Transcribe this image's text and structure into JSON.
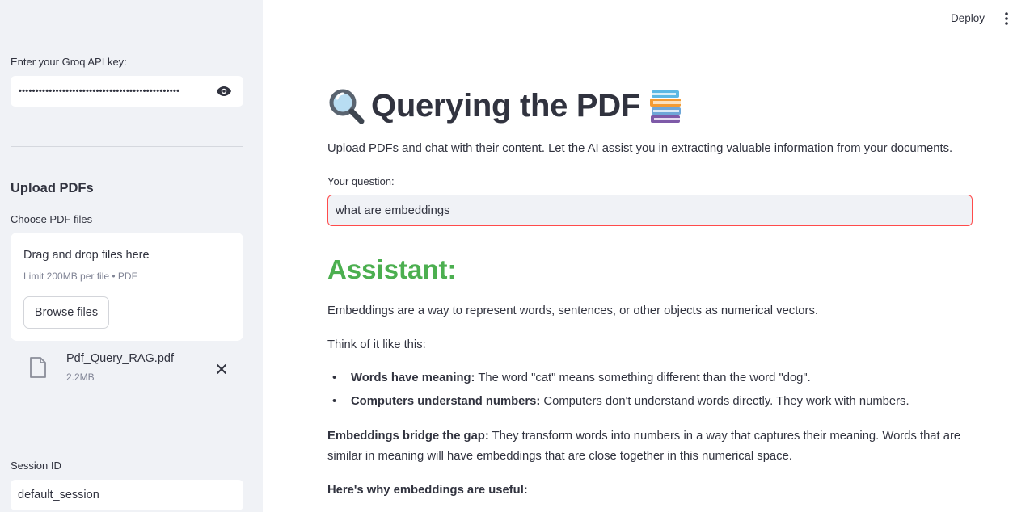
{
  "header": {
    "deploy_label": "Deploy",
    "menu_icon": "vertical-dots-icon"
  },
  "sidebar": {
    "api_key_label": "Enter your Groq API key:",
    "api_key_value": "••••••••••••••••••••••••••••••••••••••••••••••••",
    "upload_heading": "Upload PDFs",
    "choose_label": "Choose PDF files",
    "dropzone_title": "Drag and drop files here",
    "dropzone_limit": "Limit 200MB per file • PDF",
    "browse_label": "Browse files",
    "file": {
      "name": "Pdf_Query_RAG.pdf",
      "size": "2.2MB"
    },
    "session_label": "Session ID",
    "session_value": "default_session"
  },
  "main": {
    "title": "Querying the PDF",
    "title_icons": [
      "magnifying-glass-icon",
      "books-icon"
    ],
    "subtitle": "Upload PDFs and chat with their content. Let the AI assist you in extracting valuable information from your documents.",
    "question_label": "Your question:",
    "question_value": "what are embeddings",
    "assistant_heading": "Assistant:",
    "answer": {
      "intro": "Embeddings are a way to represent words, sentences, or other objects as numerical vectors.",
      "think": "Think of it like this:",
      "bullets": [
        {
          "bold": "Words have meaning:",
          "text": " The word \"cat\" means something different than the word \"dog\"."
        },
        {
          "bold": "Computers understand numbers:",
          "text": " Computers don't understand words directly. They work with numbers."
        }
      ],
      "bridge_bold": "Embeddings bridge the gap:",
      "bridge_text": " They transform words into numbers in a way that captures their meaning. Words that are similar in meaning will have embeddings that are close together in this numerical space.",
      "why": "Here's why embeddings are useful:"
    }
  },
  "colors": {
    "sidebar_bg": "#F0F2F6",
    "assistant_green": "#4CAF50",
    "input_border_focus": "#FF4B4B"
  }
}
